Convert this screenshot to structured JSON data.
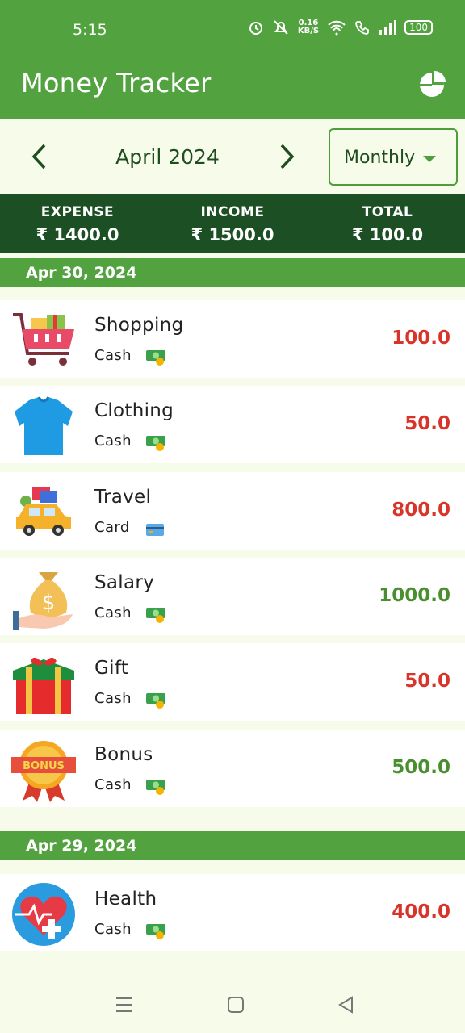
{
  "status_bar": {
    "time": "5:15",
    "net_speed_top": "0.16",
    "net_speed_bottom": "KB/S",
    "battery": "100"
  },
  "app": {
    "title": "Money Tracker"
  },
  "period": {
    "label": "April 2024",
    "mode": "Monthly"
  },
  "summary": {
    "expense_label": "EXPENSE",
    "expense_value": "₹ 1400.0",
    "income_label": "INCOME",
    "income_value": "₹ 1500.0",
    "total_label": "TOTAL",
    "total_value": "₹ 100.0"
  },
  "groups": [
    {
      "date": "Apr 30, 2024",
      "transactions": [
        {
          "category": "Shopping",
          "account": "Cash",
          "amount": "100.0",
          "type": "expense",
          "icon": "shopping-cart-icon",
          "account_icon": "cash-icon"
        },
        {
          "category": "Clothing",
          "account": "Cash",
          "amount": "50.0",
          "type": "expense",
          "icon": "tshirt-icon",
          "account_icon": "cash-icon"
        },
        {
          "category": "Travel",
          "account": "Card",
          "amount": "800.0",
          "type": "expense",
          "icon": "car-luggage-icon",
          "account_icon": "card-icon"
        },
        {
          "category": "Salary",
          "account": "Cash",
          "amount": "1000.0",
          "type": "income",
          "icon": "money-bag-hand-icon",
          "account_icon": "cash-icon"
        },
        {
          "category": "Gift",
          "account": "Cash",
          "amount": "50.0",
          "type": "expense",
          "icon": "gift-box-icon",
          "account_icon": "cash-icon"
        },
        {
          "category": "Bonus",
          "account": "Cash",
          "amount": "500.0",
          "type": "income",
          "icon": "bonus-badge-icon",
          "account_icon": "cash-icon"
        }
      ]
    },
    {
      "date": "Apr 29, 2024",
      "transactions": [
        {
          "category": "Health",
          "account": "Cash",
          "amount": "400.0",
          "type": "expense",
          "icon": "health-heart-icon",
          "account_icon": "cash-icon"
        }
      ]
    }
  ],
  "colors": {
    "primary": "#52a23f",
    "dark": "#1d4f24",
    "expense": "#d8342a",
    "income": "#4a8f2f",
    "background": "#f7fbe9"
  },
  "bonus_badge_text": "BONUS"
}
